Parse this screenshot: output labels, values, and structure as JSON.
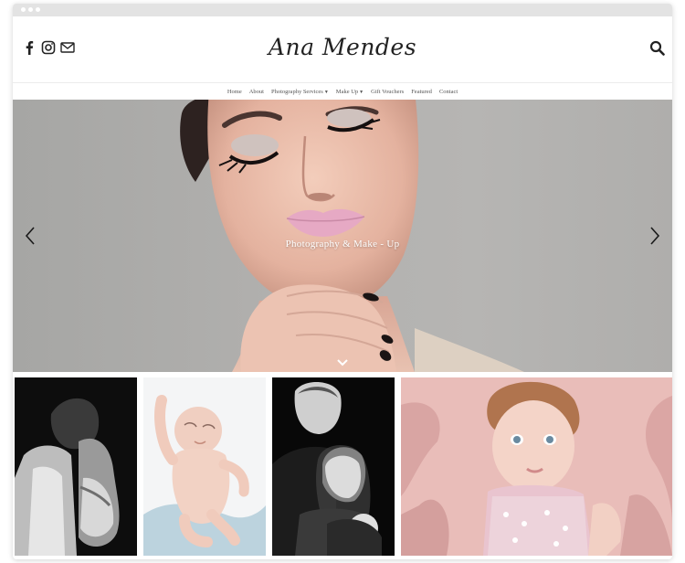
{
  "site": {
    "brand": "Ana Mendes",
    "social": [
      {
        "icon": "facebook-icon"
      },
      {
        "icon": "instagram-icon"
      },
      {
        "icon": "envelope-icon"
      }
    ],
    "search_icon": "search-icon"
  },
  "nav": {
    "items": [
      {
        "label": "Home"
      },
      {
        "label": "About"
      },
      {
        "label": "Photography Services",
        "dropdown": true
      },
      {
        "label": "Make Up",
        "dropdown": true
      },
      {
        "label": "Gift Vouchers"
      },
      {
        "label": "Featured"
      },
      {
        "label": "Contact"
      }
    ]
  },
  "hero": {
    "caption": "Photography & Make - Up",
    "prev_icon": "chevron-left-icon",
    "next_icon": "chevron-right-icon",
    "scroll_icon": "chevron-down-icon"
  },
  "gallery": {
    "tiles": [
      {
        "name": "maternity-couple-photo"
      },
      {
        "name": "newborn-baby-photo"
      },
      {
        "name": "family-portrait-photo"
      },
      {
        "name": "toddler-portrait-photo"
      }
    ]
  },
  "colors": {
    "text": "#222222",
    "nav_text": "#555555",
    "hero_bg": "#b1b0ae",
    "lips": "#e6a9c4",
    "fur_pink": "#e8b9b6"
  }
}
